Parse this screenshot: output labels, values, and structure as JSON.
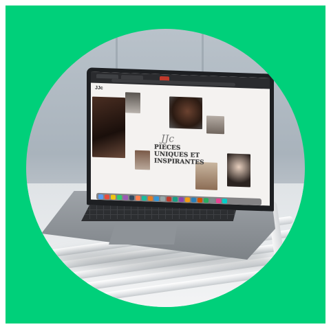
{
  "colors": {
    "background": "#00d07a",
    "wall": "#b4bec7",
    "laptop": "#8c9196"
  },
  "screen": {
    "logo": "JJc",
    "nav": [
      "",
      "",
      ""
    ],
    "headline": "PIECES UNIQUES ET INSPIRANTES",
    "mark": "JJc"
  },
  "dock_colors": [
    "#5a9cf0",
    "#e74c3c",
    "#f1c40f",
    "#2ecc71",
    "#9b59b6",
    "#34495e",
    "#ff7f50",
    "#1abc9c",
    "#e67e22",
    "#3498db",
    "#95a5a6",
    "#c0392b",
    "#16a085",
    "#8e44ad",
    "#f39c12",
    "#2980b9",
    "#d35400",
    "#27ae60",
    "#7f8c8d",
    "#e84393",
    "#00cec9"
  ]
}
